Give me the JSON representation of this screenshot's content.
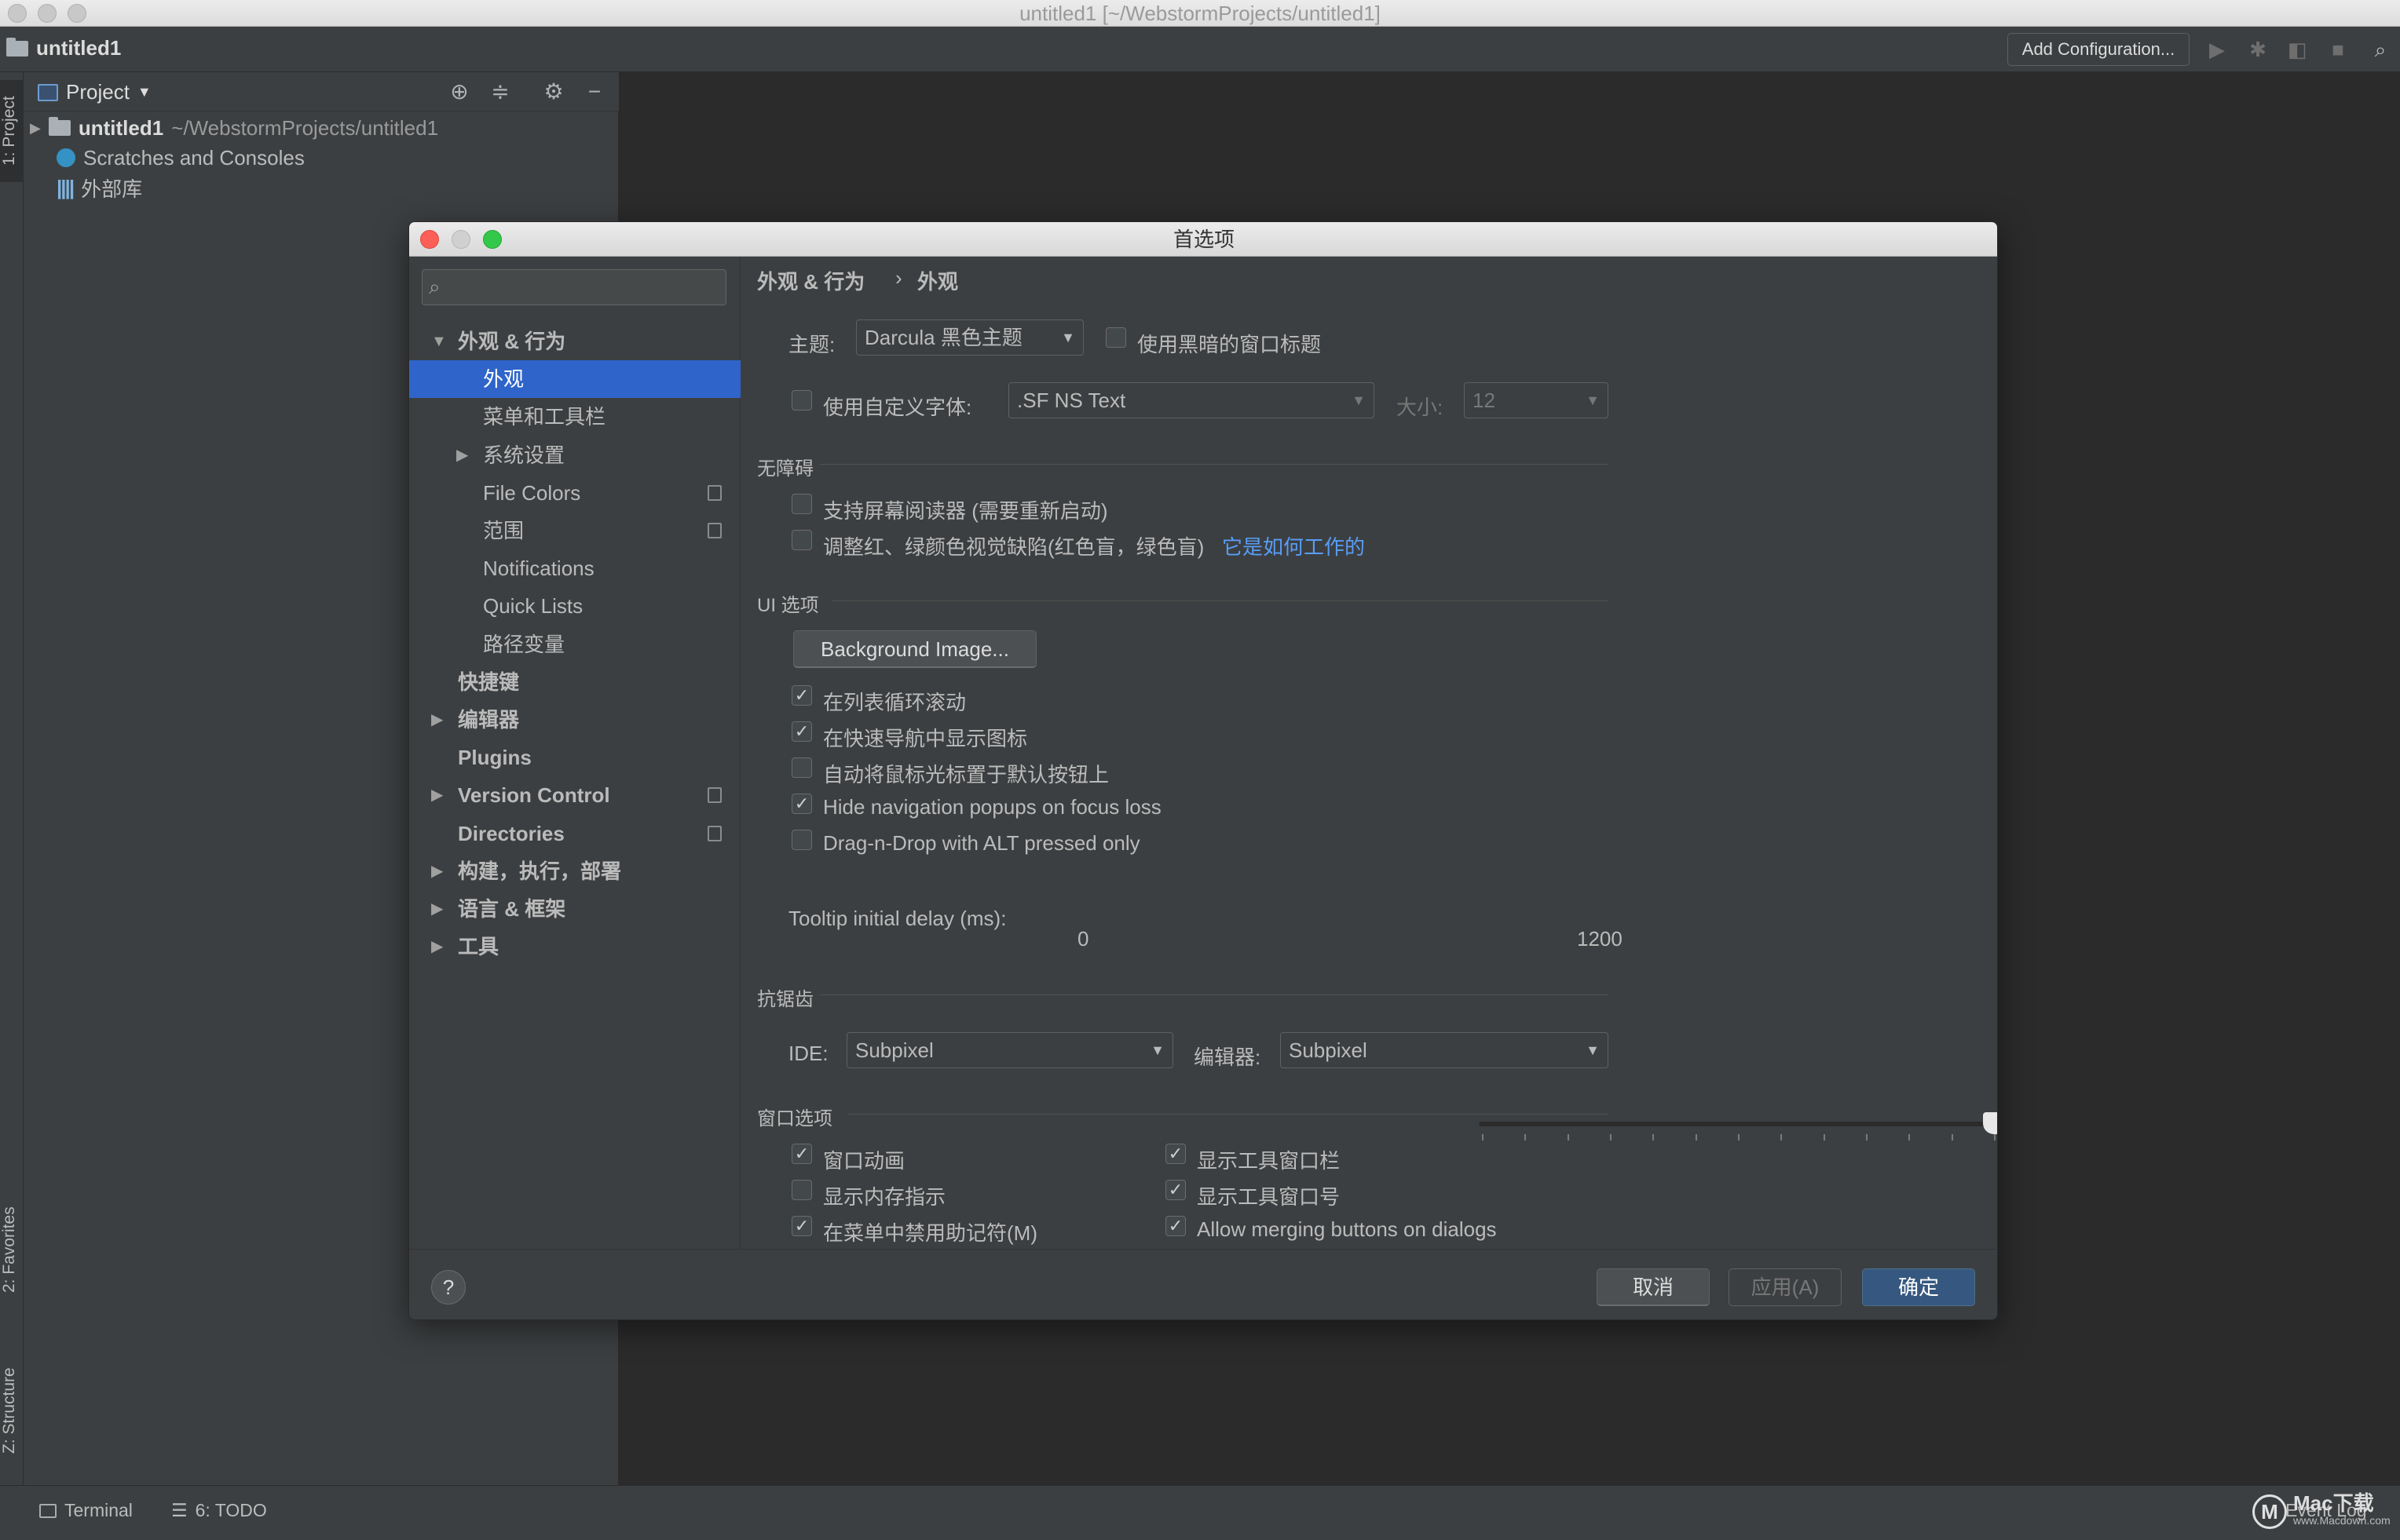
{
  "window": {
    "title": "untitled1 [~/WebstormProjects/untitled1]"
  },
  "navbar": {
    "project": "untitled1",
    "add_config": "Add Configuration..."
  },
  "left_strip": {
    "project_tab": "1: Project",
    "favorites_tab": "2: Favorites",
    "structure_tab": "Z: Structure"
  },
  "project_panel": {
    "title": "Project",
    "tree": [
      {
        "label": "untitled1",
        "path": "~/WebstormProjects/untitled1"
      },
      {
        "label": "Scratches and Consoles"
      },
      {
        "label": "外部库"
      }
    ]
  },
  "bottom_bar": {
    "terminal": "Terminal",
    "todo": "6: TODO",
    "event_log": "Event Log"
  },
  "dialog": {
    "title": "首选项",
    "sidebar": [
      {
        "label": "外观 & 行为",
        "level": 0,
        "arrow": "▼",
        "bold": true
      },
      {
        "label": "外观",
        "level": 1,
        "selected": true
      },
      {
        "label": "菜单和工具栏",
        "level": 1
      },
      {
        "label": "系统设置",
        "level": 1,
        "arrow": "▶"
      },
      {
        "label": "File Colors",
        "level": 1,
        "copy": true
      },
      {
        "label": "范围",
        "level": 1,
        "copy": true
      },
      {
        "label": "Notifications",
        "level": 1
      },
      {
        "label": "Quick Lists",
        "level": 1
      },
      {
        "label": "路径变量",
        "level": 1
      },
      {
        "label": "快捷键",
        "level": 0,
        "bold": true
      },
      {
        "label": "编辑器",
        "level": 0,
        "arrow": "▶",
        "bold": true
      },
      {
        "label": "Plugins",
        "level": 0,
        "bold": true
      },
      {
        "label": "Version Control",
        "level": 0,
        "arrow": "▶",
        "bold": true,
        "copy": true
      },
      {
        "label": "Directories",
        "level": 0,
        "bold": true,
        "copy": true
      },
      {
        "label": "构建，执行，部署",
        "level": 0,
        "arrow": "▶",
        "bold": true
      },
      {
        "label": "语言 & 框架",
        "level": 0,
        "arrow": "▶",
        "bold": true
      },
      {
        "label": "工具",
        "level": 0,
        "arrow": "▶",
        "bold": true
      }
    ],
    "breadcrumb": {
      "parent": "外观 & 行为",
      "sep": "›",
      "current": "外观"
    },
    "theme": {
      "label": "主题:",
      "value": "Darcula 黑色主题",
      "dark_title_label": "使用黑暗的窗口标题",
      "dark_title_checked": false
    },
    "font": {
      "custom_label": "使用自定义字体:",
      "custom_checked": false,
      "font_value": ".SF NS Text",
      "size_label": "大小:",
      "size_value": "12"
    },
    "accessibility": {
      "header": "无障碍",
      "screen_reader_label": "支持屏幕阅读器 (需要重新启动)",
      "screen_reader_checked": false,
      "color_deficiency_label": "调整红、绿颜色视觉缺陷(红色盲，绿色盲)",
      "color_deficiency_checked": false,
      "how_link": "它是如何工作的"
    },
    "ui_options": {
      "header": "UI 选项",
      "bg_button": "Background Image...",
      "checks": [
        {
          "label": "在列表循环滚动",
          "checked": true
        },
        {
          "label": "在快速导航中显示图标",
          "checked": true
        },
        {
          "label": "自动将鼠标光标置于默认按钮上",
          "checked": false
        },
        {
          "label": "Hide navigation popups on focus loss",
          "checked": true
        },
        {
          "label": "Drag-n-Drop with ALT pressed only",
          "checked": false
        }
      ],
      "tooltip_label": "Tooltip initial delay (ms):",
      "tooltip_min": "0",
      "tooltip_max": "1200",
      "tooltip_value": 1200
    },
    "antialiasing": {
      "header": "抗锯齿",
      "ide_label": "IDE:",
      "ide_value": "Subpixel",
      "editor_label": "编辑器:",
      "editor_value": "Subpixel"
    },
    "window_options": {
      "header": "窗口选项",
      "left": [
        {
          "label": "窗口动画",
          "checked": true
        },
        {
          "label": "显示内存指示",
          "checked": false
        },
        {
          "label": "在菜单中禁用助记符(M)",
          "checked": true
        }
      ],
      "right": [
        {
          "label": "显示工具窗口栏",
          "checked": true
        },
        {
          "label": "显示工具窗口号",
          "checked": true
        },
        {
          "label": "Allow merging buttons on dialogs",
          "checked": true
        }
      ]
    },
    "footer": {
      "help": "?",
      "cancel": "取消",
      "apply": "应用(A)",
      "ok": "确定"
    }
  },
  "watermark": {
    "logo": "M",
    "text": "Mac下载",
    "url": "www.Macdown.com"
  }
}
